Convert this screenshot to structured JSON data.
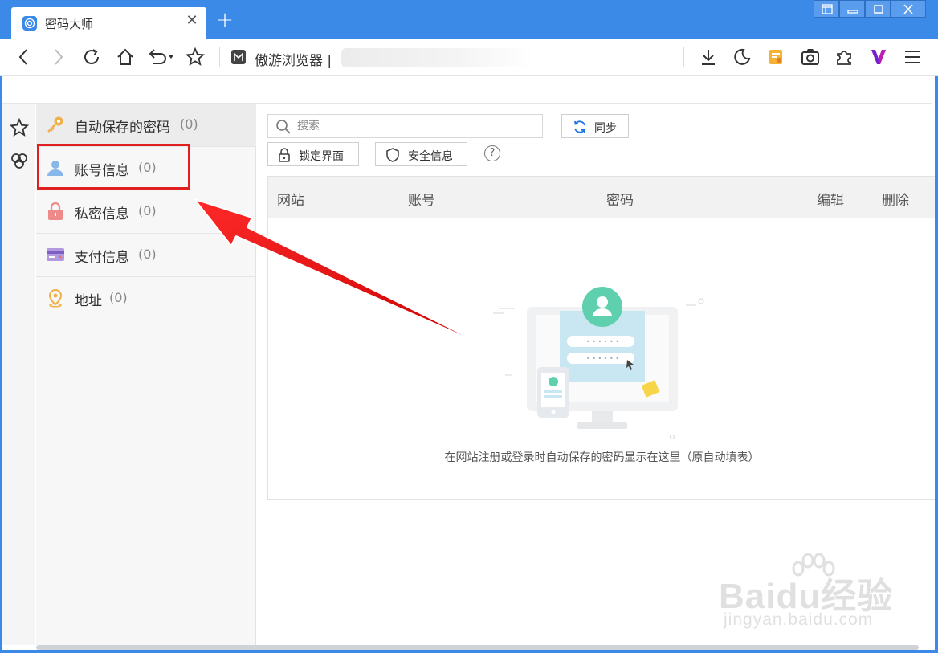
{
  "browser": {
    "tab": {
      "title": "密码大师",
      "close": "✕",
      "icon": "password-master-icon"
    },
    "new_tab": "+",
    "address": {
      "site_name": "傲游浏览器 |"
    },
    "toolbar_icons": [
      "back-icon",
      "forward-icon",
      "reload-icon",
      "home-icon",
      "undo-icon",
      "favorite-icon",
      "download-icon",
      "night-mode-icon",
      "notes-icon",
      "screenshot-icon",
      "extensions-icon",
      "v-logo-icon",
      "menu-icon"
    ]
  },
  "sidebar": {
    "items": [
      {
        "label": "自动保存的密码",
        "count": "(0)",
        "icon": "key-icon"
      },
      {
        "label": "账号信息",
        "count": "(0)",
        "icon": "user-icon"
      },
      {
        "label": "私密信息",
        "count": "(0)",
        "icon": "lock-icon"
      },
      {
        "label": "支付信息",
        "count": "(0)",
        "icon": "card-icon"
      },
      {
        "label": "地址",
        "count": "(0)",
        "icon": "location-icon"
      }
    ]
  },
  "main": {
    "search_placeholder": "搜索",
    "sync_label": "同步",
    "lock_label": "锁定界面",
    "security_label": "安全信息",
    "help": "?",
    "columns": [
      "网站",
      "账号",
      "密码",
      "编辑",
      "删除"
    ],
    "empty_message": "在网站注册或登录时自动保存的密码显示在这里（原自动填表）"
  },
  "watermark": {
    "text": "Baidu经验",
    "sub": "jingyan.baidu.com"
  },
  "colors": {
    "frame": "#3c8ae8",
    "highlight": "#e02020",
    "accent": "#1a73e8"
  }
}
